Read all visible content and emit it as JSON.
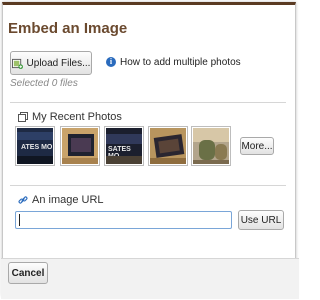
{
  "dialog": {
    "title": "Embed an Image"
  },
  "upload": {
    "button_label": "Upload Files...",
    "help_link": "How to add multiple photos",
    "selected_count": "Selected 0 files"
  },
  "recent": {
    "label": "My Recent Photos",
    "more_label": "More..."
  },
  "url": {
    "label": "An image URL",
    "value": "",
    "use_label": "Use URL"
  },
  "footer": {
    "cancel_label": "Cancel"
  },
  "colors": {
    "title": "#6b4a2f",
    "accent": "#2a6bbd",
    "frame_top": "#5a3a22"
  },
  "icons": [
    "upload-icon",
    "info-icon",
    "photos-icon",
    "link-icon"
  ]
}
